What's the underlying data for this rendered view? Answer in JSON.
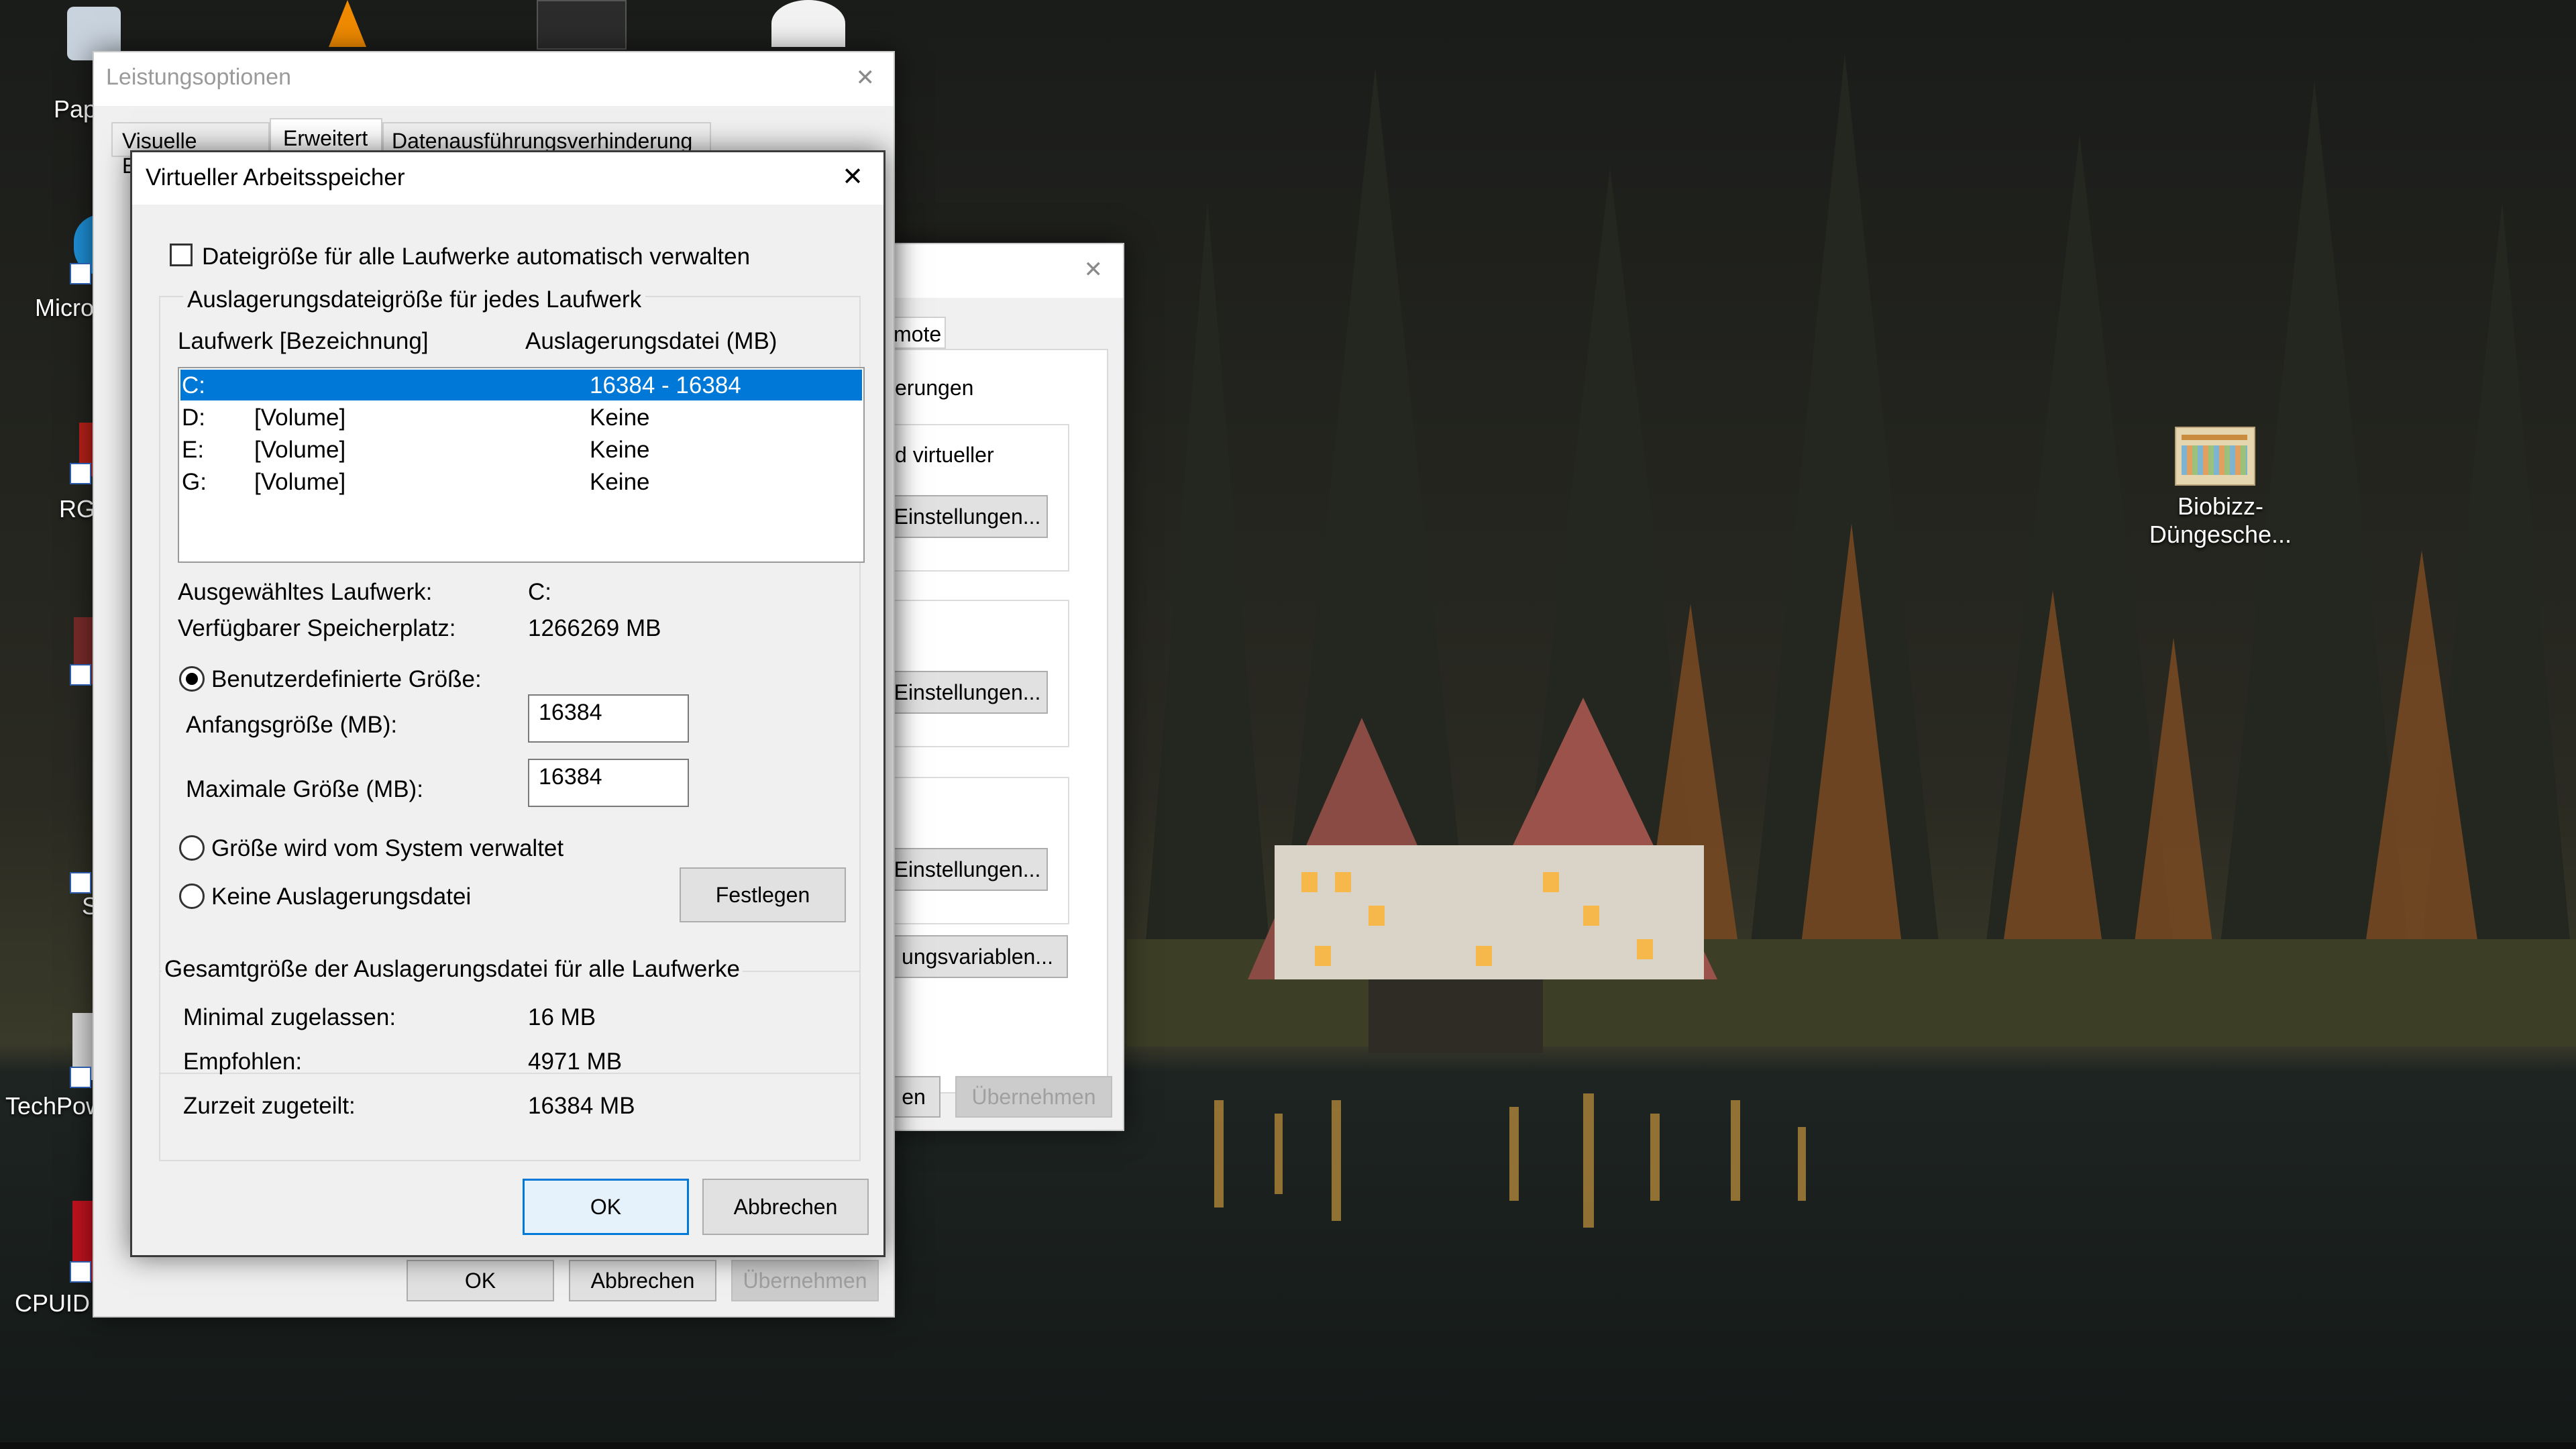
{
  "desktop": {
    "icons": [
      {
        "label": "Pap"
      },
      {
        "label": "Micro"
      },
      {
        "label": "RG"
      },
      {
        "label": "S"
      },
      {
        "label": "TechPow"
      },
      {
        "label": "CPUID"
      },
      {
        "label": "Biobizz-Düngesche..."
      }
    ]
  },
  "perf_options": {
    "title": "Leistungsoptionen",
    "tabs": [
      "Visuelle Effekte",
      "Erweitert",
      "Datenausführungsverhinderung"
    ],
    "buttons": {
      "ok": "OK",
      "cancel": "Abbrechen",
      "apply": "Übernehmen"
    }
  },
  "system_properties": {
    "tab_fragment": "mote",
    "text_fragment_1": "erungen",
    "text_fragment_2": "d virtueller",
    "settings_buttons": [
      "Einstellungen...",
      "Einstellungen...",
      "Einstellungen..."
    ],
    "env_button": "ungsvariablen...",
    "bottom_fragment": "en",
    "apply": "Übernehmen"
  },
  "virtual_memory": {
    "title": "Virtueller Arbeitsspeicher",
    "auto_manage_label": "Dateigröße für alle Laufwerke automatisch verwalten",
    "auto_manage_checked": false,
    "group_title": "Auslagerungsdateigröße für jedes Laufwerk",
    "col_drive": "Laufwerk [Bezeichnung]",
    "col_pagefile": "Auslagerungsdatei (MB)",
    "drives": [
      {
        "drive": "C:",
        "label": "",
        "size": "16384 - 16384",
        "selected": true
      },
      {
        "drive": "D:",
        "label": "[Volume]",
        "size": "Keine",
        "selected": false
      },
      {
        "drive": "E:",
        "label": "[Volume]",
        "size": "Keine",
        "selected": false
      },
      {
        "drive": "G:",
        "label": "[Volume]",
        "size": "Keine",
        "selected": false
      }
    ],
    "selected_drive_label": "Ausgewähltes Laufwerk:",
    "selected_drive_value": "C:",
    "free_space_label": "Verfügbarer Speicherplatz:",
    "free_space_value": "1266269 MB",
    "custom_size_label": "Benutzerdefinierte Größe:",
    "initial_size_label": "Anfangsgröße (MB):",
    "initial_size_value": "16384",
    "max_size_label": "Maximale Größe (MB):",
    "max_size_value": "16384",
    "system_managed_label": "Größe wird vom System verwaltet",
    "no_pagefile_label": "Keine Auslagerungsdatei",
    "set_button": "Festlegen",
    "total_group_title": "Gesamtgröße der Auslagerungsdatei für alle Laufwerke",
    "min_label": "Minimal zugelassen:",
    "min_value": "16 MB",
    "recommended_label": "Empfohlen:",
    "recommended_value": "4971 MB",
    "allocated_label": "Zurzeit zugeteilt:",
    "allocated_value": "16384 MB",
    "ok": "OK",
    "cancel": "Abbrechen",
    "selected_option": "custom"
  },
  "colors": {
    "accent": "#0078d7",
    "dialog_bg": "#f0f0f0"
  }
}
